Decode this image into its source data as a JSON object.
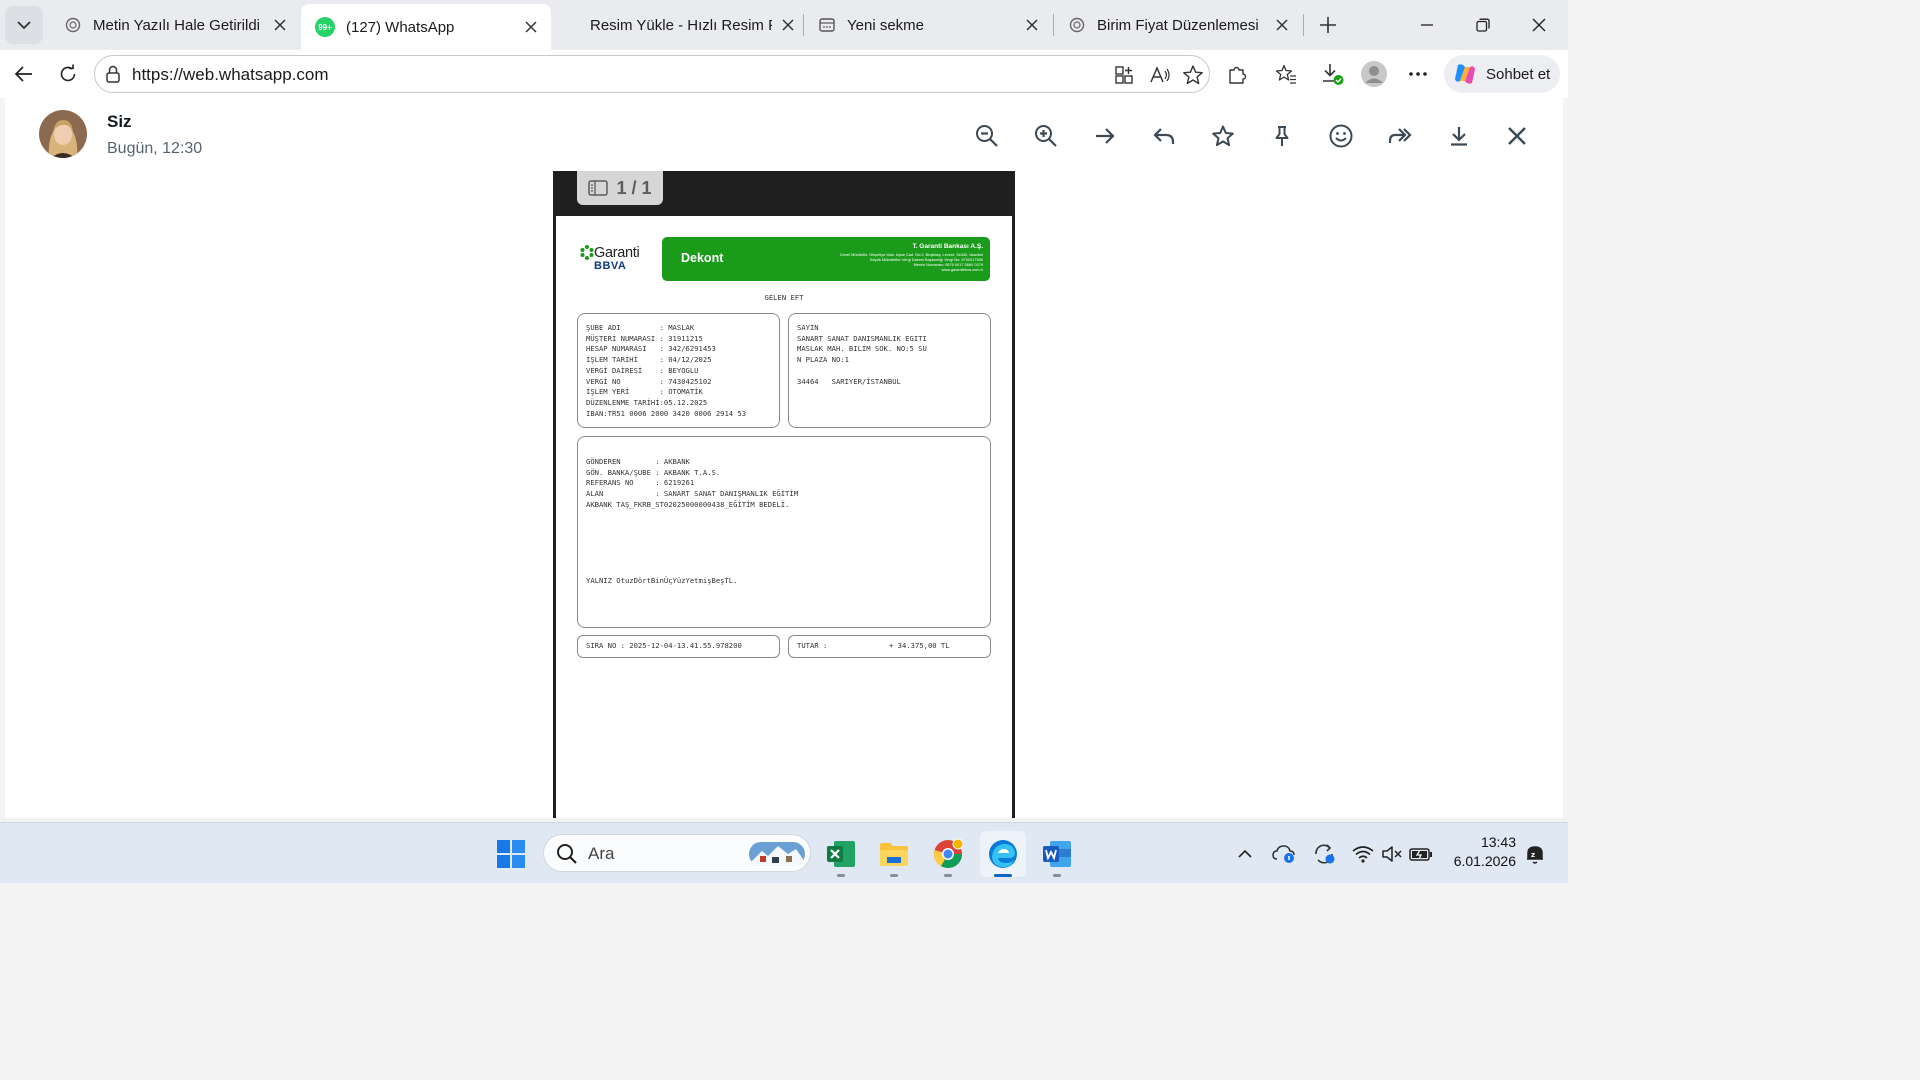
{
  "browser": {
    "tabs": [
      {
        "title": "Metin Yazılı Hale Getirildi",
        "active": false
      },
      {
        "title": "(127) WhatsApp",
        "active": true,
        "badge": "99+"
      },
      {
        "title": "Resim Yükle - Hızlı Resim Paylaş",
        "active": false
      },
      {
        "title": "Yeni sekme",
        "active": false
      },
      {
        "title": "Birim Fiyat Düzenlemesi",
        "active": false
      }
    ],
    "url": "https://web.whatsapp.com",
    "copilot_label": "Sohbet et"
  },
  "viewer": {
    "sender_name": "Siz",
    "timestamp": "Bugün, 12:30",
    "page_counter": "1 / 1"
  },
  "receipt": {
    "bank_logo_main": "Garanti",
    "bank_logo_sub": "BBVA",
    "doc_title": "Dekont",
    "bank_name": "T. Garanti Bankası A.Ş.",
    "bank_info": [
      "Genel Müdürlük: Nispetiye Mah. Aytar Cad. No:2, Beşiktaş, Levent, 34340, İstanbul",
      "Büyük Mükellefler Vergi Dairesi Başkanlığı Vergi No: 8790017566",
      "Mersis Numarası: 0879 0017 5660 0379",
      "www.garantibbva.com.tr"
    ],
    "transfer_type": "GELEN EFT",
    "account_lines": [
      "ŞUBE ADI         : MASLAK",
      "MÜŞTERİ NUMARASI : 31911215",
      "HESAP NUMARASI   : 342/6291453",
      "İŞLEM TARİHİ     : 04/12/2025",
      "VERGİ DAİRESİ    : BEYOGLU",
      "VERGİ NO         : 7430425102",
      "İŞLEM YERİ       : OTOMATİK",
      "DÜZENLENME TARİHİ:05.12.2025",
      "IBAN:TR51 0006 2000 3420 0006 2914 53"
    ],
    "recipient_lines": [
      "SAYIN",
      "SANART SANAT DANISMANLIK EGITI",
      "MASLAK MAH. BILIM SOK. NO:5 SU",
      "N PLAZA NO:1",
      "",
      "34464   SARIYER/İSTANBUL"
    ],
    "details_lines": [
      "GÖNDEREN        : AKBANK",
      "GÖN. BANKA/ŞUBE : AKBANK T.A.S.",
      "REFERANS NO     : 6219261",
      "ALAN            : SANART SANAT DANIŞMANLIK EĞİTİM",
      "AKBANK TAŞ_FKRB_ST02025000000438_EĞİTİM BEDELİ."
    ],
    "amount_in_words": "YALNIZ OtuzDörtBinÜçYüzYetmişBeşTL.",
    "sequence_no": "SIRA NO : 2025-12-04-13.41.55.978200",
    "amount_label": "TUTAR :",
    "amount_value": "+ 34.375,00 TL"
  },
  "taskbar": {
    "search_placeholder": "Ara",
    "time": "13:43",
    "date": "6.01.2026"
  },
  "colors": {
    "garanti_green": "#1a9b1a",
    "whatsapp_green": "#25d366",
    "edge_blue": "#0a7bd6"
  }
}
